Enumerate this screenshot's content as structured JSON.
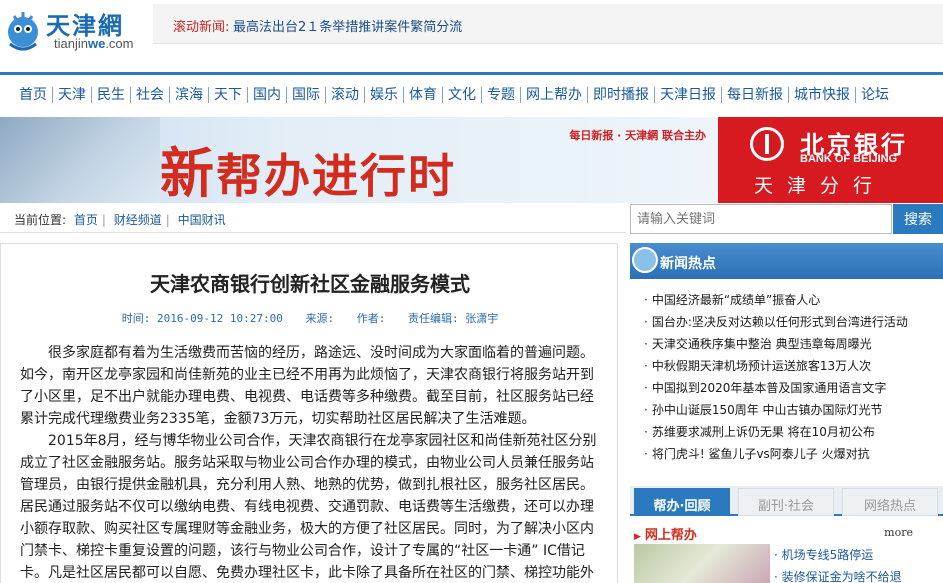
{
  "site": {
    "logo_cn": "天津網",
    "logo_url_pre": "tianjin",
    "logo_url_we": "we",
    "logo_url_post": ".com"
  },
  "ticker": {
    "label": "滚动新闻:",
    "text": "最高法出台2１条举措推讲案件繁简分流"
  },
  "nav": [
    "首页",
    "天津",
    "民生",
    "社会",
    "滨海",
    "天下",
    "国内",
    "国际",
    "滚动",
    "娱乐",
    "体育",
    "文化",
    "专题",
    "网上帮办",
    "即时播报",
    "天津日报",
    "每日新报",
    "城市快报",
    "论坛"
  ],
  "banner": {
    "title_big": "新",
    "title_rest": "帮办进行时",
    "sponsor": "每日新报 · 天津網 联合主办"
  },
  "bank": {
    "name": "北京银行",
    "en": "BANK OF BEIJING",
    "branch": "天津分行"
  },
  "breadcrumb": {
    "label": "当前位置:",
    "items": [
      "首页",
      "财经频道",
      "中国财讯"
    ]
  },
  "search": {
    "placeholder": "请输入关键词",
    "button": "搜索"
  },
  "article": {
    "title": "天津农商银行创新社区金融服务模式",
    "time": "时间: 2016-09-12 10:27:00",
    "source": "来源:",
    "author": "作者:",
    "editor": "责任编辑: 张潇宇",
    "paragraphs": [
      "很多家庭都有着为生活缴费而苦恼的经历，路途远、没时间成为大家面临着的普遍问题。如今，南开区龙亭家园和尚佳新苑的业主已经不用再为此烦恼了，天津农商银行将服务站开到了小区里，足不出户就能办理电费、电视费、电话费等多种缴费。截至目前，社区服务站已经累计完成代理缴费业务2335笔，金额73万元，切实帮助社区居民解决了生活难题。",
      "2015年8月，经与博华物业公司合作，天津农商银行在龙亭家园社区和尚佳新苑社区分别成立了社区金融服务站。服务站采取与物业公司合作办理的模式，由物业公司人员兼任服务站管理员，由银行提供金融机具，充分利用人熟、地熟的优势，做到扎根社区，服务社区居民。居民通过服务站不仅可以缴纳电费、有线电视费、交通罚款、电话费等生活缴费，还可以办理小额存取款、购买社区专属理财等金融业务，极大的方便了社区居民。同时，为了解决小区内门禁卡、梯控卡重复设置的问题，该行与物业公司合作，设计了专属的“社区一卡通” IC借记卡。凡是社区居民都可以自愿、免费办理社区卡，此卡除了具备所在社区的门禁、梯控功能外"
    ]
  },
  "hot": {
    "title": "新闻热点",
    "items": [
      "中国经济最新“成绩单”振奋人心",
      "国台办:坚决反对达赖以任何形式到台湾进行活动",
      "天津交通秩序集中整治 典型违章每周曝光",
      "中秋假期天津机场预计运送旅客13万人次",
      "中国拟到2020年基本普及国家通用语言文字",
      "孙中山诞辰150周年 中山古镇办国际灯光节",
      "苏维要求减刑上诉仍无果 将在10月初公布",
      "将门虎斗! 鲨鱼儿子vs阿泰儿子 火爆对抗"
    ]
  },
  "tabs": [
    "帮办·回顾",
    "副刊·社会",
    "网络热点"
  ],
  "help": {
    "title": "网上帮办",
    "more": "more",
    "items": [
      "机场专线5路停运",
      "装修保证金为啥不给退"
    ]
  },
  "colors": {
    "brand_blue": "#2b7ac0",
    "accent_red": "#d32b1e",
    "bank_red": "#d71920"
  }
}
